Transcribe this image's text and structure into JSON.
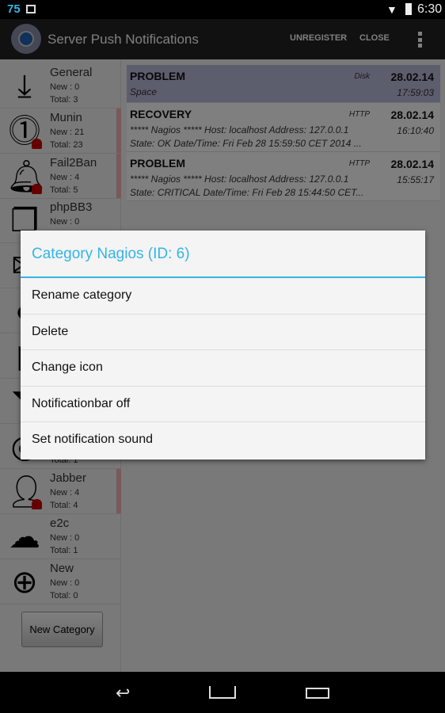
{
  "status": {
    "notification_count": "75",
    "time": "6:30"
  },
  "actionbar": {
    "title": "Server Push Notifications",
    "unregister": "UNREGISTER",
    "close": "CLOSE"
  },
  "categories": [
    {
      "name": "General",
      "new": "New :  0",
      "total": "Total: 3",
      "icon": "download-icon",
      "alert": false
    },
    {
      "name": "Munin",
      "new": "New : 21",
      "total": "Total: 23",
      "icon": "exclamation-icon",
      "alert": true
    },
    {
      "name": "Fail2Ban",
      "new": "New : 4",
      "total": "Total: 5",
      "icon": "bell-icon",
      "alert": true
    },
    {
      "name": "phpBB3",
      "new": "New :  0",
      "total": "",
      "icon": "chat-icon",
      "alert": false
    },
    {
      "name": "",
      "new": "",
      "total": "Total: 1",
      "icon": "wifi-icon",
      "alert": false
    },
    {
      "name": "Jabber",
      "new": "New :  4",
      "total": "Total: 4",
      "icon": "user-icon",
      "alert": true
    },
    {
      "name": "e2c",
      "new": "New : 0",
      "total": "Total: 1",
      "icon": "cloud-icon",
      "alert": false
    },
    {
      "name": "New",
      "new": "New :  0",
      "total": "Total: 0",
      "icon": "plus-circle-icon",
      "alert": false
    }
  ],
  "new_category_button": "New Category",
  "notifications": [
    {
      "type": "PROBLEM",
      "service": "Disk",
      "date": "28.02.14",
      "time": "17:59:03",
      "line1": "Space",
      "line2": ""
    },
    {
      "type": "RECOVERY",
      "service": "HTTP",
      "date": "28.02.14",
      "time": "16:10:40",
      "line1": "***** Nagios *****  Host: localhost Address: 127.0.0.1",
      "line2": "State: OK  Date/Time: Fri Feb 28 15:59:50 CET 2014 ..."
    },
    {
      "type": "PROBLEM",
      "service": "HTTP",
      "date": "28.02.14",
      "time": "15:55:17",
      "line1": "***** Nagios *****  Host: localhost Address: 127.0.0.1",
      "line2": "State: CRITICAL  Date/Time: Fri Feb 28 15:44:50 CET..."
    }
  ],
  "dialog": {
    "title": "Category Nagios (ID: 6)",
    "items": [
      "Rename category",
      "Delete",
      "Change icon",
      "Notificationbar off",
      "Set notification sound"
    ]
  },
  "colors": {
    "accent": "#33b5e5",
    "alert_bell": "#cc0000",
    "selected_row": "#b8bcdc"
  }
}
